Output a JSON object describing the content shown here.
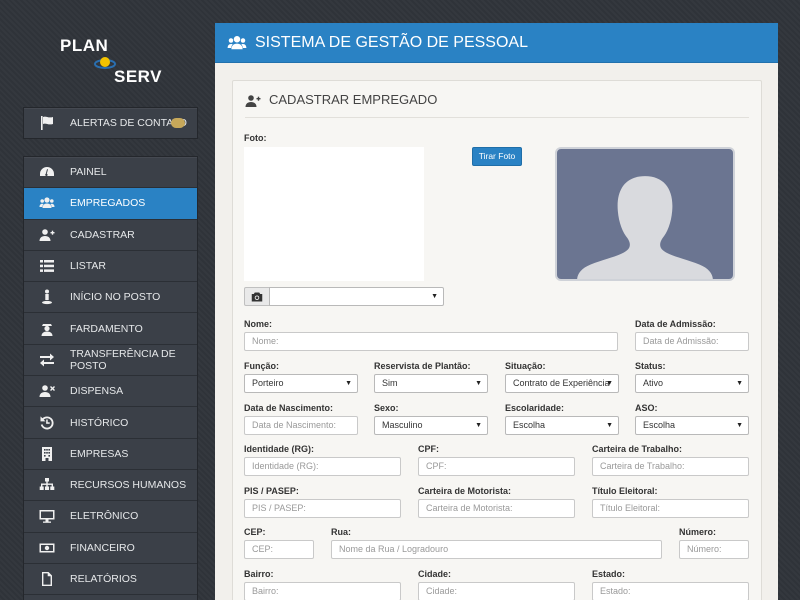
{
  "brand": {
    "line1": "PLAN",
    "line2": "SERV"
  },
  "alerts": {
    "label": "Alertas de Contato",
    "count": ""
  },
  "menu": [
    {
      "label": "Painel",
      "icon": "dashboard-icon"
    },
    {
      "label": "Empregados",
      "icon": "users-icon",
      "active": true
    },
    {
      "label": "Cadastrar",
      "icon": "user-plus-icon"
    },
    {
      "label": "Listar",
      "icon": "list-icon"
    },
    {
      "label": "Início no Posto",
      "icon": "person-start-icon"
    },
    {
      "label": "Fardamento",
      "icon": "uniform-icon"
    },
    {
      "label": "Transferência de Posto",
      "icon": "transfer-icon"
    },
    {
      "label": "Dispensa",
      "icon": "user-remove-icon"
    },
    {
      "label": "Histórico",
      "icon": "history-icon"
    },
    {
      "label": "Empresas",
      "icon": "building-icon"
    },
    {
      "label": "Recursos Humanos",
      "icon": "sitemap-icon"
    },
    {
      "label": "Eletrônico",
      "icon": "monitor-icon"
    },
    {
      "label": "Financeiro",
      "icon": "money-icon"
    },
    {
      "label": "Relatórios",
      "icon": "file-icon"
    }
  ],
  "header": {
    "title": "SISTEMA DE GESTÃO DE PESSOAL"
  },
  "card": {
    "title": "CADASTRAR EMPREGADO"
  },
  "photo": {
    "label": "Foto:",
    "take_button": "Tirar Foto",
    "camera_select": ""
  },
  "form": {
    "nome": {
      "label": "Nome:",
      "placeholder": "Nome:"
    },
    "admissao": {
      "label": "Data de Admissão:",
      "placeholder": "Data de Admissão:"
    },
    "funcao": {
      "label": "Função:",
      "value": "Porteiro"
    },
    "reservista": {
      "label": "Reservista de Plantão:",
      "value": "Sim"
    },
    "situacao": {
      "label": "Situação:",
      "value": "Contrato de Experiência"
    },
    "status": {
      "label": "Status:",
      "value": "Ativo"
    },
    "nascimento": {
      "label": "Data de Nascimento:",
      "placeholder": "Data de Nascimento:"
    },
    "sexo": {
      "label": "Sexo:",
      "value": "Masculino"
    },
    "escolaridade": {
      "label": "Escolaridade:",
      "value": "Escolha"
    },
    "aso": {
      "label": "ASO:",
      "value": "Escolha"
    },
    "rg": {
      "label": "Identidade (RG):",
      "placeholder": "Identidade (RG):"
    },
    "cpf": {
      "label": "CPF:",
      "placeholder": "CPF:"
    },
    "ctps": {
      "label": "Carteira de Trabalho:",
      "placeholder": "Carteira de Trabalho:"
    },
    "pis": {
      "label": "PIS / PASEP:",
      "placeholder": "PIS / PASEP:"
    },
    "cnh": {
      "label": "Carteira de Motorista:",
      "placeholder": "Carteira de Motorista:"
    },
    "titulo": {
      "label": "Título Eleitoral:",
      "placeholder": "Título Eleitoral:"
    },
    "cep": {
      "label": "CEP:",
      "placeholder": "CEP:"
    },
    "rua": {
      "label": "Rua:",
      "placeholder": "Nome da Rua / Logradouro"
    },
    "numero": {
      "label": "Número:",
      "placeholder": "Número:"
    },
    "bairro": {
      "label": "Bairro:",
      "placeholder": "Bairro:"
    },
    "cidade": {
      "label": "Cidade:",
      "placeholder": "Cidade:"
    },
    "estado": {
      "label": "Estado:",
      "placeholder": "Estado:"
    }
  },
  "colors": {
    "primary": "#2a82c4",
    "sidebar": "#3b4048",
    "background": "#2f3339",
    "badge": "#c7a85a"
  }
}
